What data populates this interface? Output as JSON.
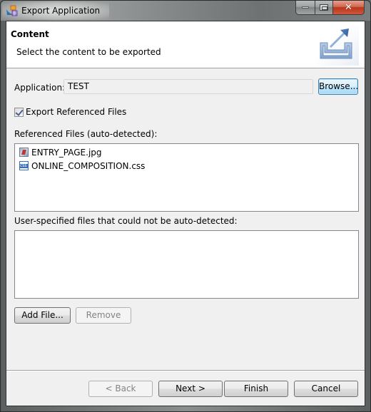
{
  "window": {
    "title": "Export Application",
    "icon": "export-app-icon",
    "controls": {
      "minimize": "minimize-icon",
      "maximize": "maximize-icon",
      "close": "close-icon",
      "close_glyph": "✕"
    }
  },
  "header": {
    "title": "Content",
    "description": "Select the content to be exported",
    "image": "export-banner-icon"
  },
  "application": {
    "label": "Application:",
    "value": "TEST",
    "browse_label": "Browse..."
  },
  "export_referenced": {
    "label": "Export Referenced Files",
    "checked": true
  },
  "referenced_files": {
    "label": "Referenced Files (auto-detected):",
    "items": [
      {
        "name": "ENTRY_PAGE.jpg",
        "icon": "image-file-icon"
      },
      {
        "name": "ONLINE_COMPOSITION.css",
        "icon": "css-file-icon"
      }
    ]
  },
  "user_files": {
    "label": "User-specified files that could not be auto-detected:",
    "items": [],
    "add_label": "Add File...",
    "remove_label": "Remove",
    "remove_enabled": false
  },
  "footer": {
    "back_label": "< Back",
    "back_enabled": false,
    "next_label": "Next >",
    "finish_label": "Finish",
    "cancel_label": "Cancel"
  },
  "colors": {
    "client_bg": "#f0f0f0",
    "close_button": "#c94a2e",
    "focus_border": "#3c7fb1"
  }
}
